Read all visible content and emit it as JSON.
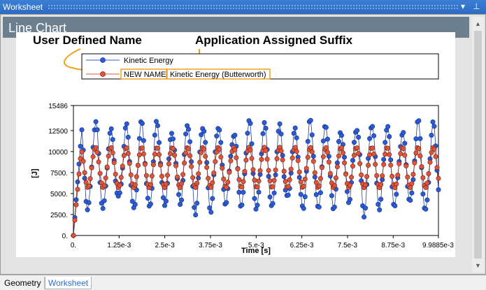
{
  "window": {
    "title": "Worksheet"
  },
  "panel": {
    "title": "Line Chart"
  },
  "annotations": {
    "user_defined": "User Defined Name",
    "app_suffix": "Application Assigned Suffix"
  },
  "tabs": [
    {
      "label": "Geometry",
      "active": false
    },
    {
      "label": "Worksheet",
      "active": true
    }
  ],
  "chart_data": {
    "type": "line",
    "xlabel": "Time [s]",
    "ylabel": "[J]",
    "xlim": [
      0,
      0.0099885
    ],
    "ylim": [
      0,
      15486
    ],
    "x_ticks": [
      "0.",
      "1.25e-3",
      "2.5e-3",
      "3.75e-3",
      "5.e-3",
      "6.25e-3",
      "7.5e-3",
      "8.75e-3",
      "9.9885e-3"
    ],
    "y_ticks": [
      "0.",
      "2500.",
      "5000.",
      "7500.",
      "10000",
      "12500",
      "15486"
    ],
    "legend": {
      "placement": "top",
      "entries": [
        {
          "label": "Kinetic Energy"
        },
        {
          "prefix": "NEW NAME",
          "suffix": "Kinetic Energy (Butterworth)"
        }
      ]
    },
    "series": [
      {
        "name": "Kinetic Energy",
        "color": "#2a5bd7",
        "approx_model": {
          "mean": 8200,
          "amplitude": 4800,
          "period_s": 0.00042,
          "max": 15486,
          "rise_until_s": 0.0002
        }
      },
      {
        "name": "NEW NAME Kinetic Energy (Butterworth)",
        "color": "#e0553a",
        "approx_model": {
          "mean": 8100,
          "amplitude": 2400,
          "period_s": 0.00042,
          "rise_until_s": 0.0002
        }
      }
    ]
  },
  "colors": {
    "accent": "#2b6fc6",
    "highlight": "#f0a020",
    "header": "#6b7f8e"
  }
}
